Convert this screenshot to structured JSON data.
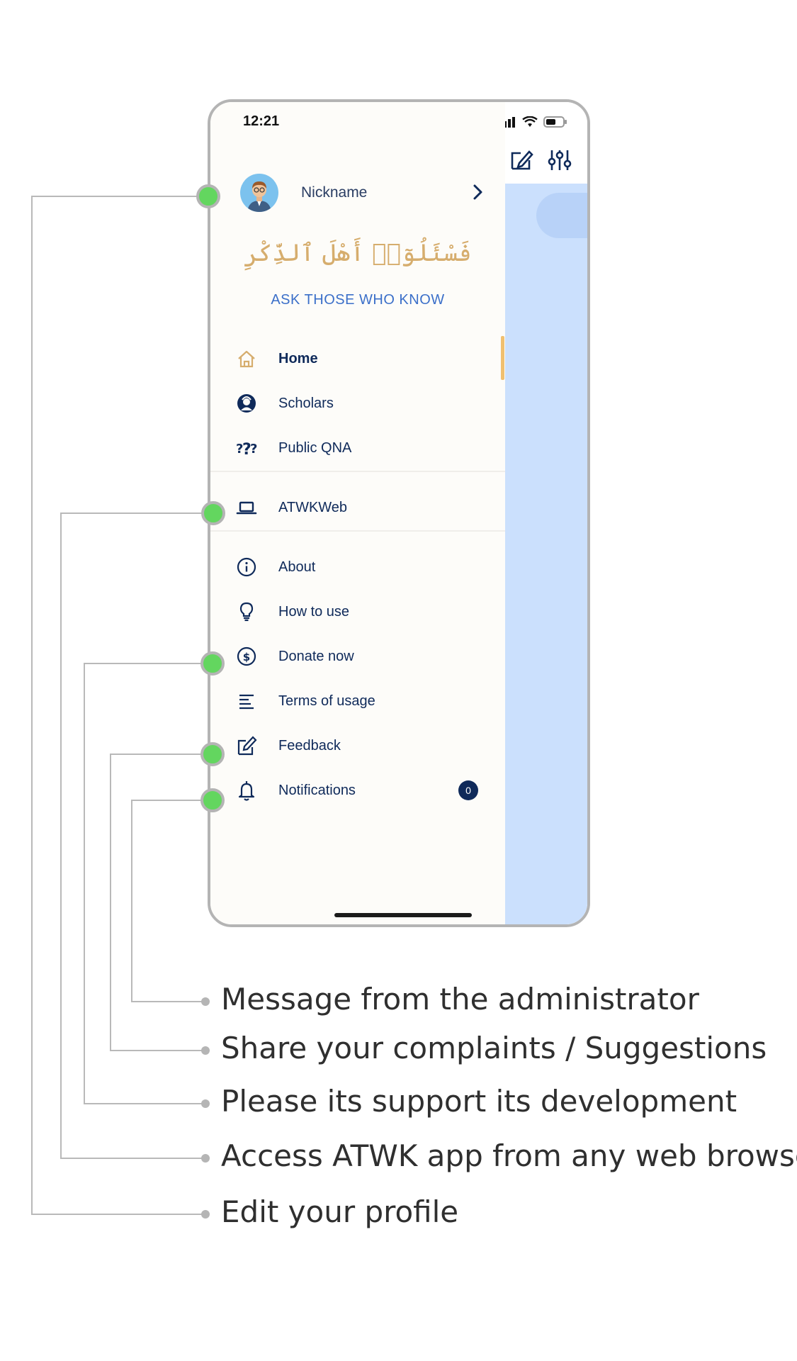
{
  "status_bar": {
    "time": "12:21"
  },
  "profile": {
    "nickname": "Nickname"
  },
  "app": {
    "arabic_title": "فَسْئَلُوٓا۟ أَهْلَ ٱلذِّكْرِ",
    "tagline": "ASK THOSE WHO KNOW"
  },
  "menu": {
    "home": "Home",
    "scholars": "Scholars",
    "public_qna": "Public QNA",
    "atwkweb": "ATWKWeb",
    "about": "About",
    "how_to_use": "How to use",
    "donate": "Donate now",
    "terms": "Terms of usage",
    "feedback": "Feedback",
    "notifications": "Notifications",
    "notifications_count": "0"
  },
  "captions": {
    "notifications": "Message from the administrator",
    "feedback": "Share your complaints / Suggestions",
    "donate": "Please its support its development",
    "atwkweb": "Access ATWK app from any web browser",
    "profile": "Edit your profile"
  },
  "colors": {
    "accent": "#3b6fc9",
    "navy": "#0f2a5a",
    "gold": "#d6ad6d",
    "callout_dot": "#63d65f",
    "app_background": "#cbe0fd"
  }
}
